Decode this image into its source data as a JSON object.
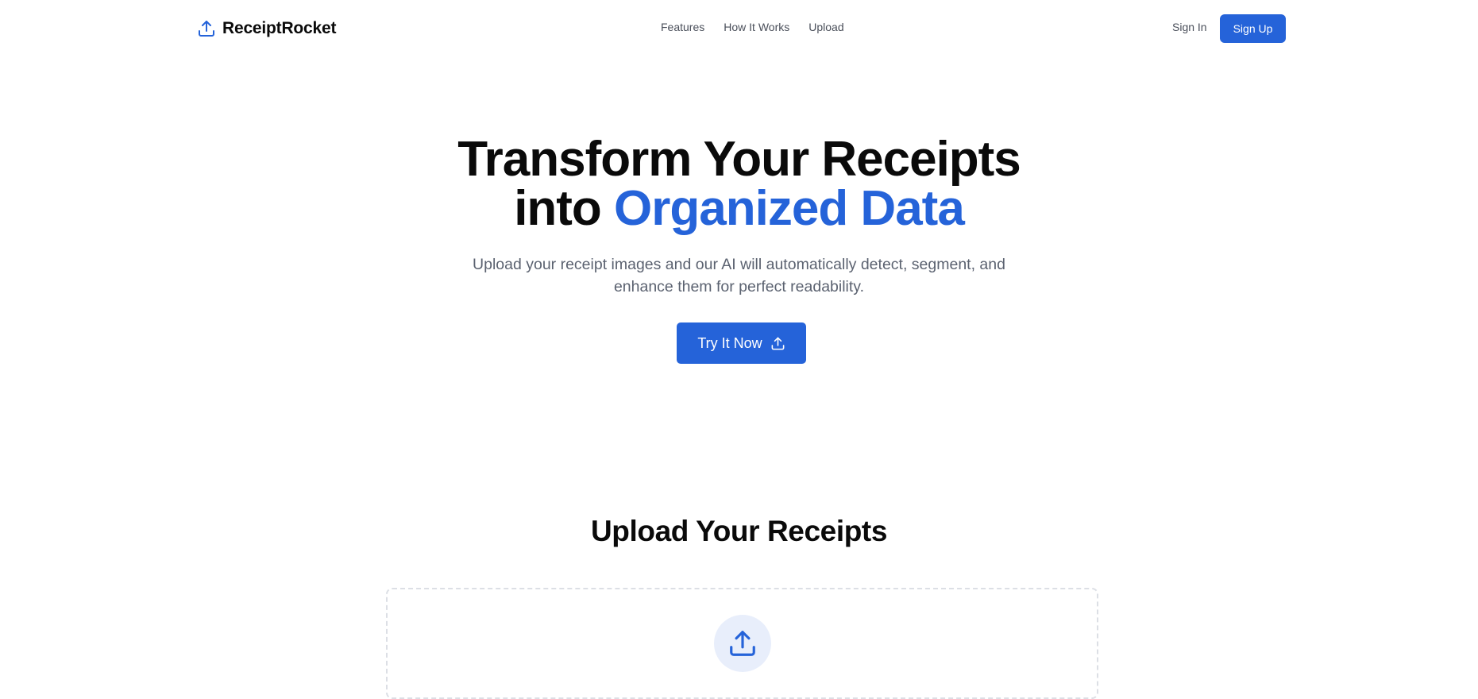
{
  "brand": {
    "name": "ReceiptRocket",
    "icon": "upload-icon",
    "accent_color": "#2563d9"
  },
  "nav": {
    "links": [
      "Features",
      "How It Works",
      "Upload"
    ],
    "sign_in": "Sign In",
    "sign_up": "Sign Up"
  },
  "hero": {
    "title_line1": "Transform Your Receipts",
    "title_line2_prefix": "into ",
    "title_line2_accent": "Organized Data",
    "subtitle": "Upload your receipt images and our AI will automatically detect, segment, and enhance them for perfect readability.",
    "cta_label": "Try It Now",
    "cta_icon": "upload-icon"
  },
  "upload_section": {
    "title": "Upload Your Receipts",
    "dropzone_icon": "upload-icon"
  }
}
